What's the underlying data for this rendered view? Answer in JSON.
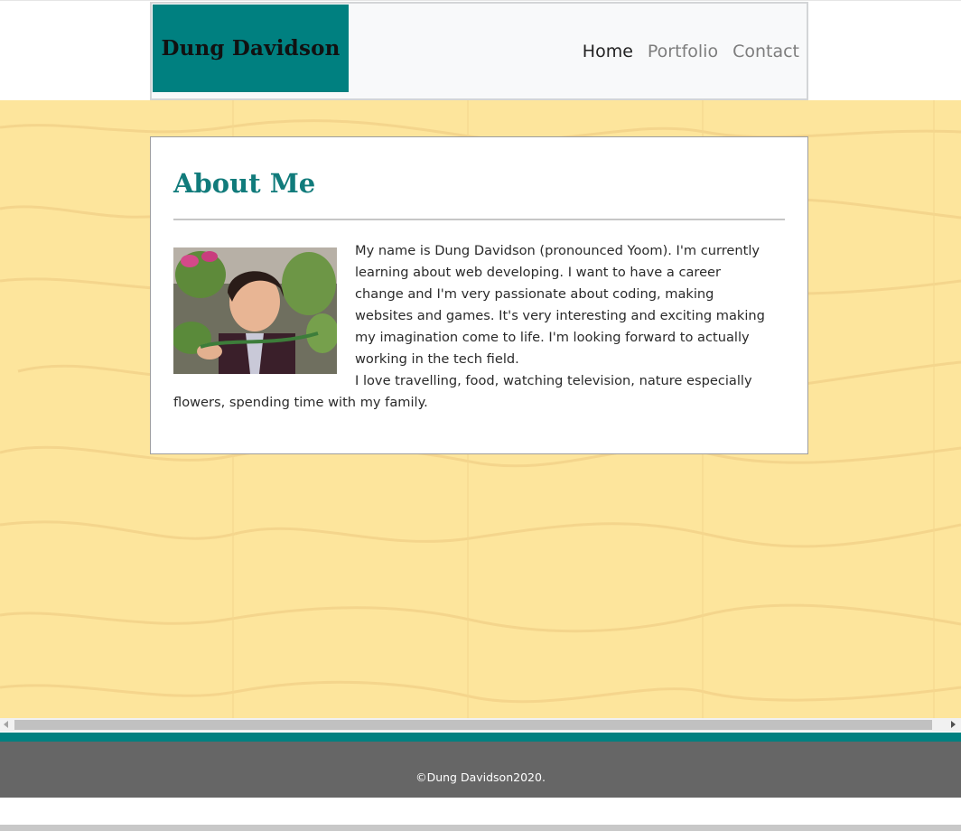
{
  "brand": {
    "name": "Dung Davidson",
    "bg_color": "#008080"
  },
  "nav": {
    "links": [
      {
        "label": "Home",
        "active": true
      },
      {
        "label": "Portfolio",
        "active": false
      },
      {
        "label": "Contact",
        "active": false
      }
    ]
  },
  "about": {
    "title": "About Me",
    "photo_alt": "profile-photo",
    "paragraph_1": "My name is Dung Davidson (pronounced Yoom). I'm currently learning about web developing. I want to have a career change and I'm very passionate about coding, making websites and games. It's very interesting and exciting making my imagination come to life. I'm looking forward to actually working in the tech field.",
    "paragraph_2": "I love travelling, food, watching television, nature especially flowers, spending time with my family."
  },
  "footer": {
    "text": "©Dung Davidson2020."
  },
  "colors": {
    "accent": "#008080",
    "title": "#117b7b",
    "wood": "#fde59c",
    "footer": "#666666"
  }
}
